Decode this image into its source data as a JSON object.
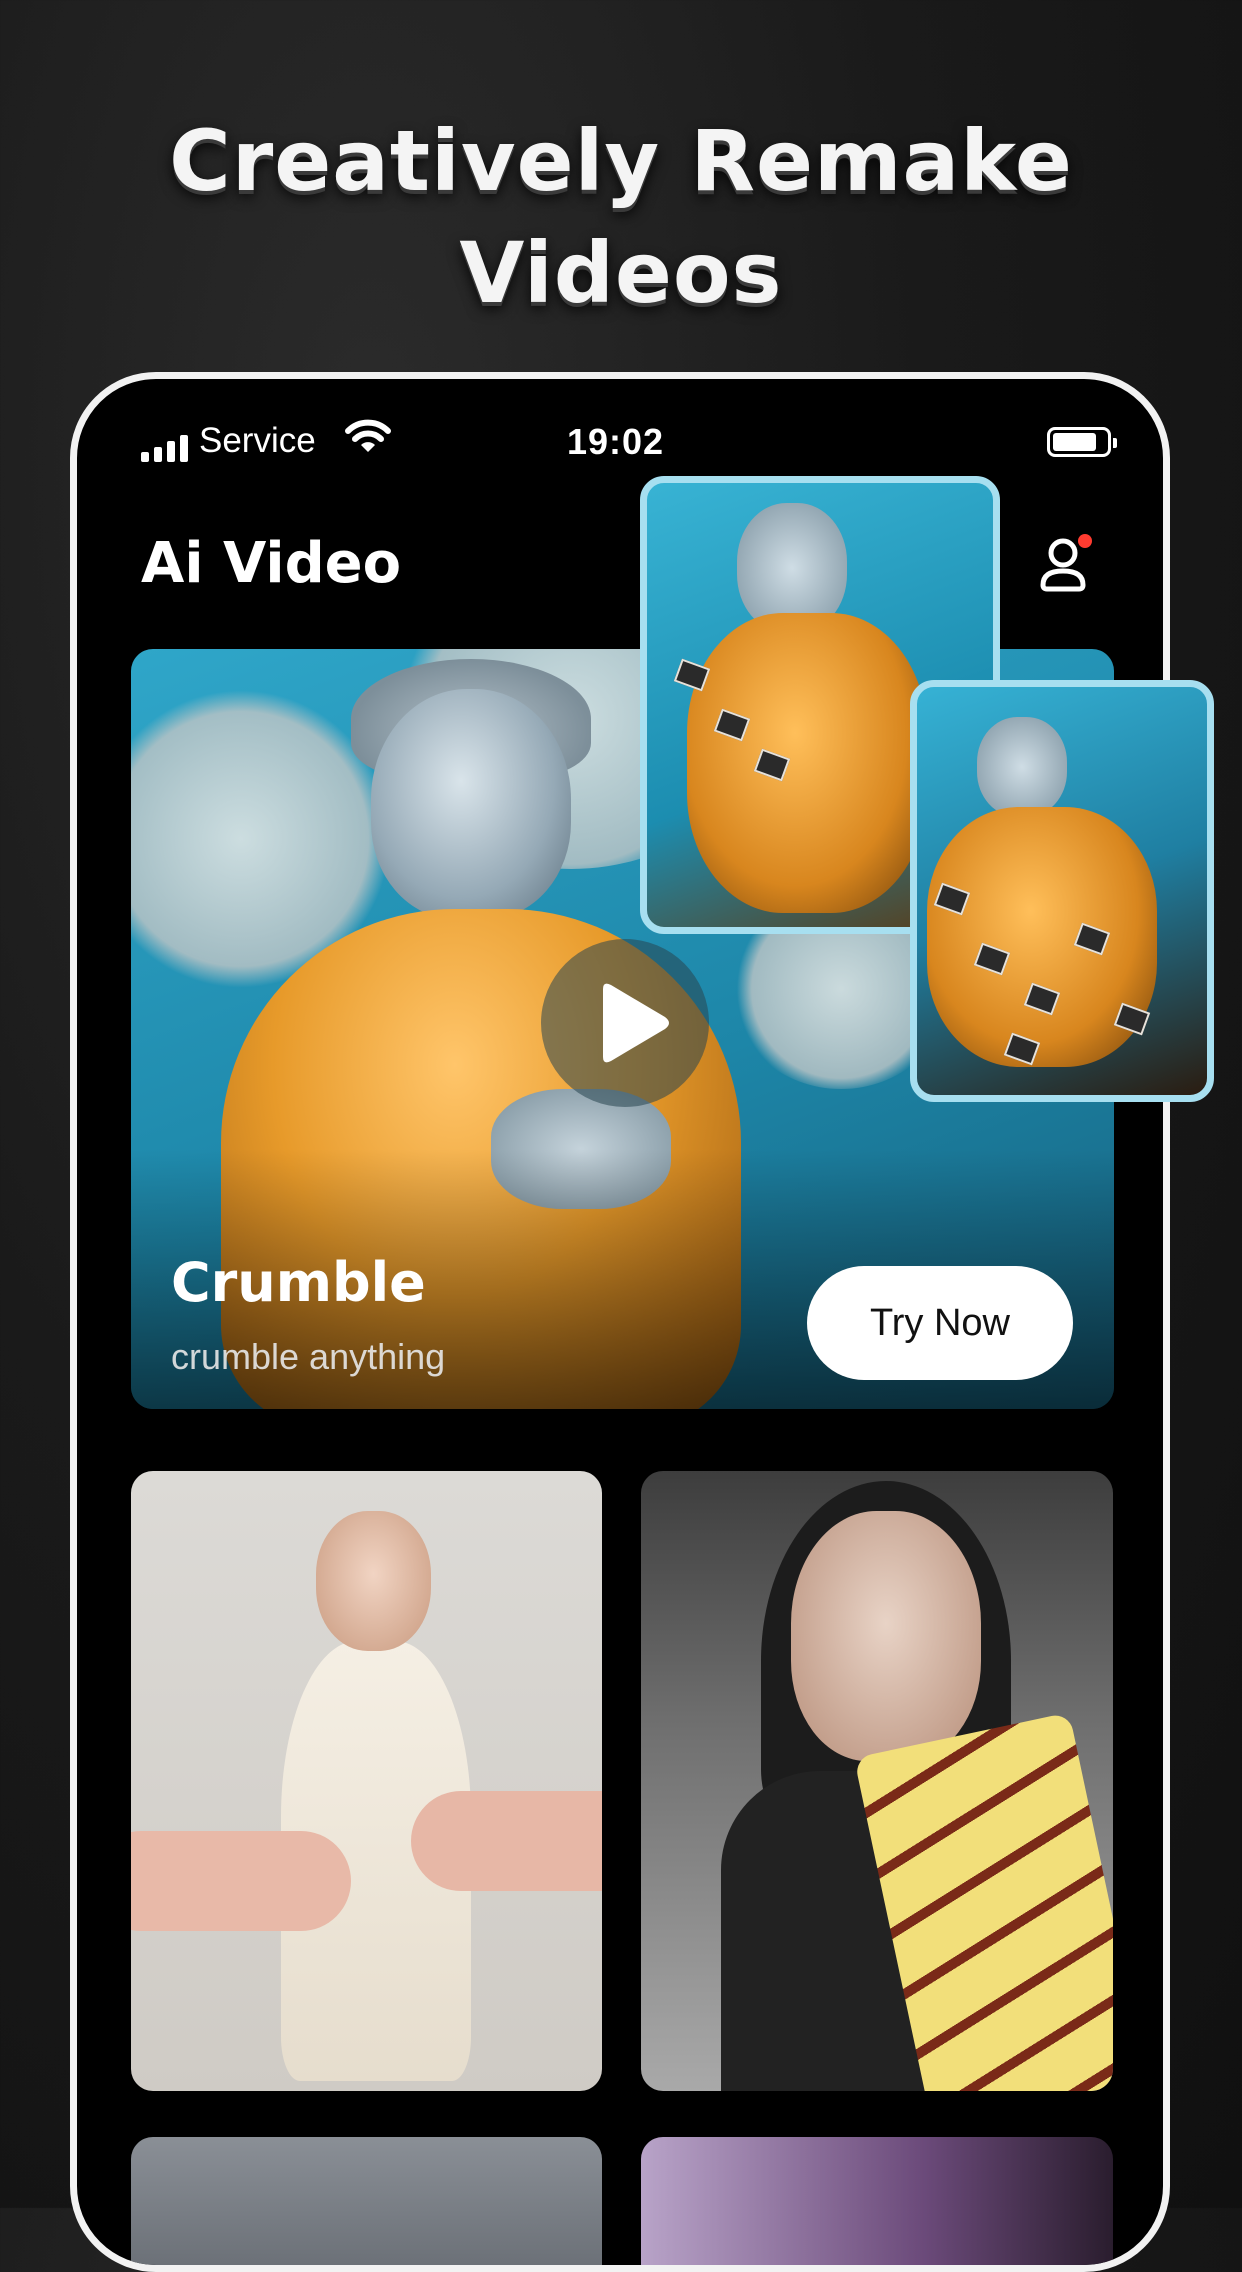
{
  "headline": {
    "line1": "Creatively Remake",
    "line2": "Videos"
  },
  "status_bar": {
    "carrier": "Service",
    "time": "19:02"
  },
  "app": {
    "title": "Ai Video",
    "profile_badge_color": "#ff3b30"
  },
  "hero": {
    "title": "Crumble",
    "subtitle": "crumble anything",
    "cta_label": "Try Now",
    "accent": "#a7dff0"
  },
  "icons": [
    "signal-icon",
    "wifi-icon",
    "battery-icon",
    "profile-icon",
    "play-icon"
  ]
}
